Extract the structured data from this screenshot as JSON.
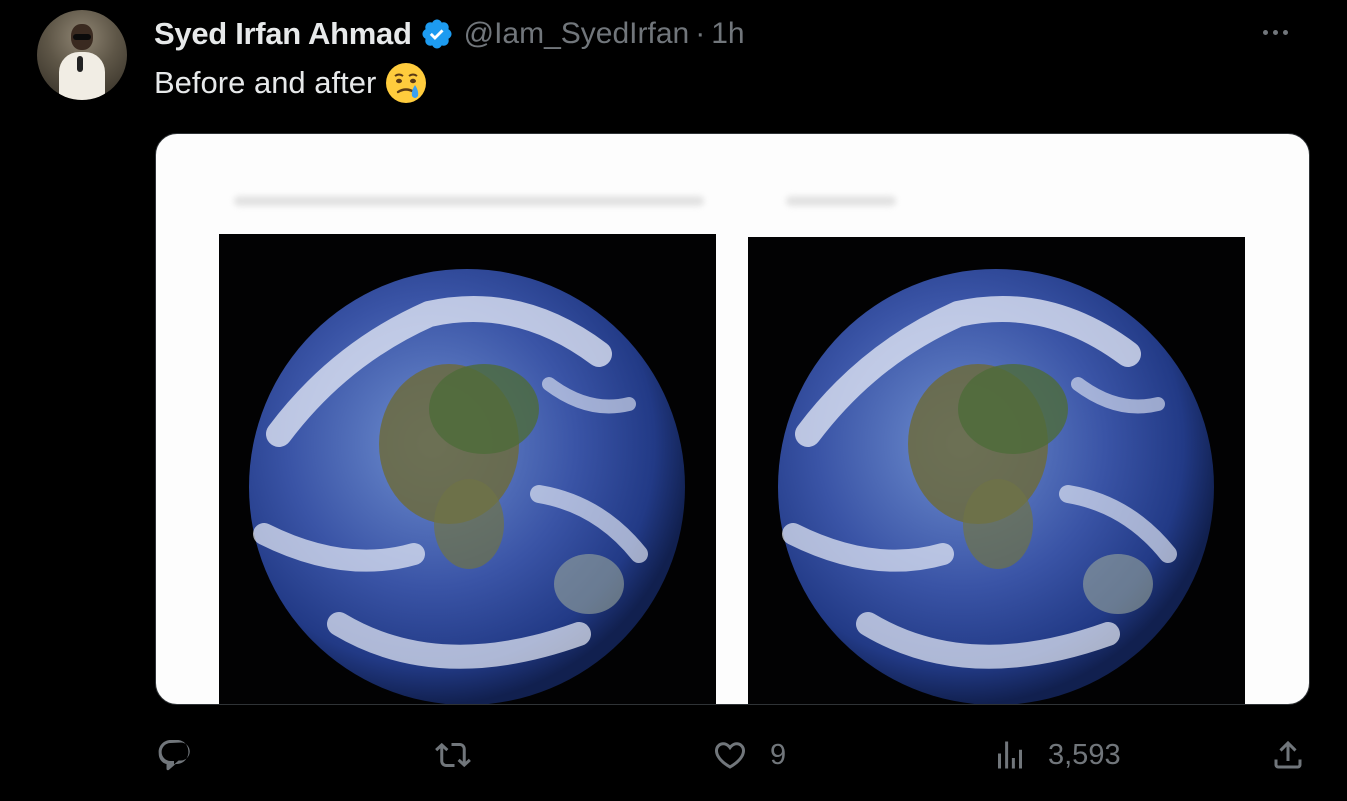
{
  "tweet": {
    "author_name": "Syed Irfan Ahmad",
    "handle": "@Iam_SyedIrfan",
    "separator": "·",
    "time": "1h",
    "text": "Before and after",
    "emoji": "face-holding-back-tears",
    "verified_color": "#1d9bf0"
  },
  "icons": {
    "avatar": "user-avatar",
    "verified": "verified-badge-icon",
    "more": "more-options-icon",
    "media": "earth-globe-image"
  },
  "actions": {
    "reply_count": "",
    "retweet_count": "",
    "like_count": "9",
    "views_count": "3,593"
  },
  "colors": {
    "background": "#000000",
    "text": "#e7e9ea",
    "muted": "#71767b",
    "accent": "#1d9bf0"
  }
}
